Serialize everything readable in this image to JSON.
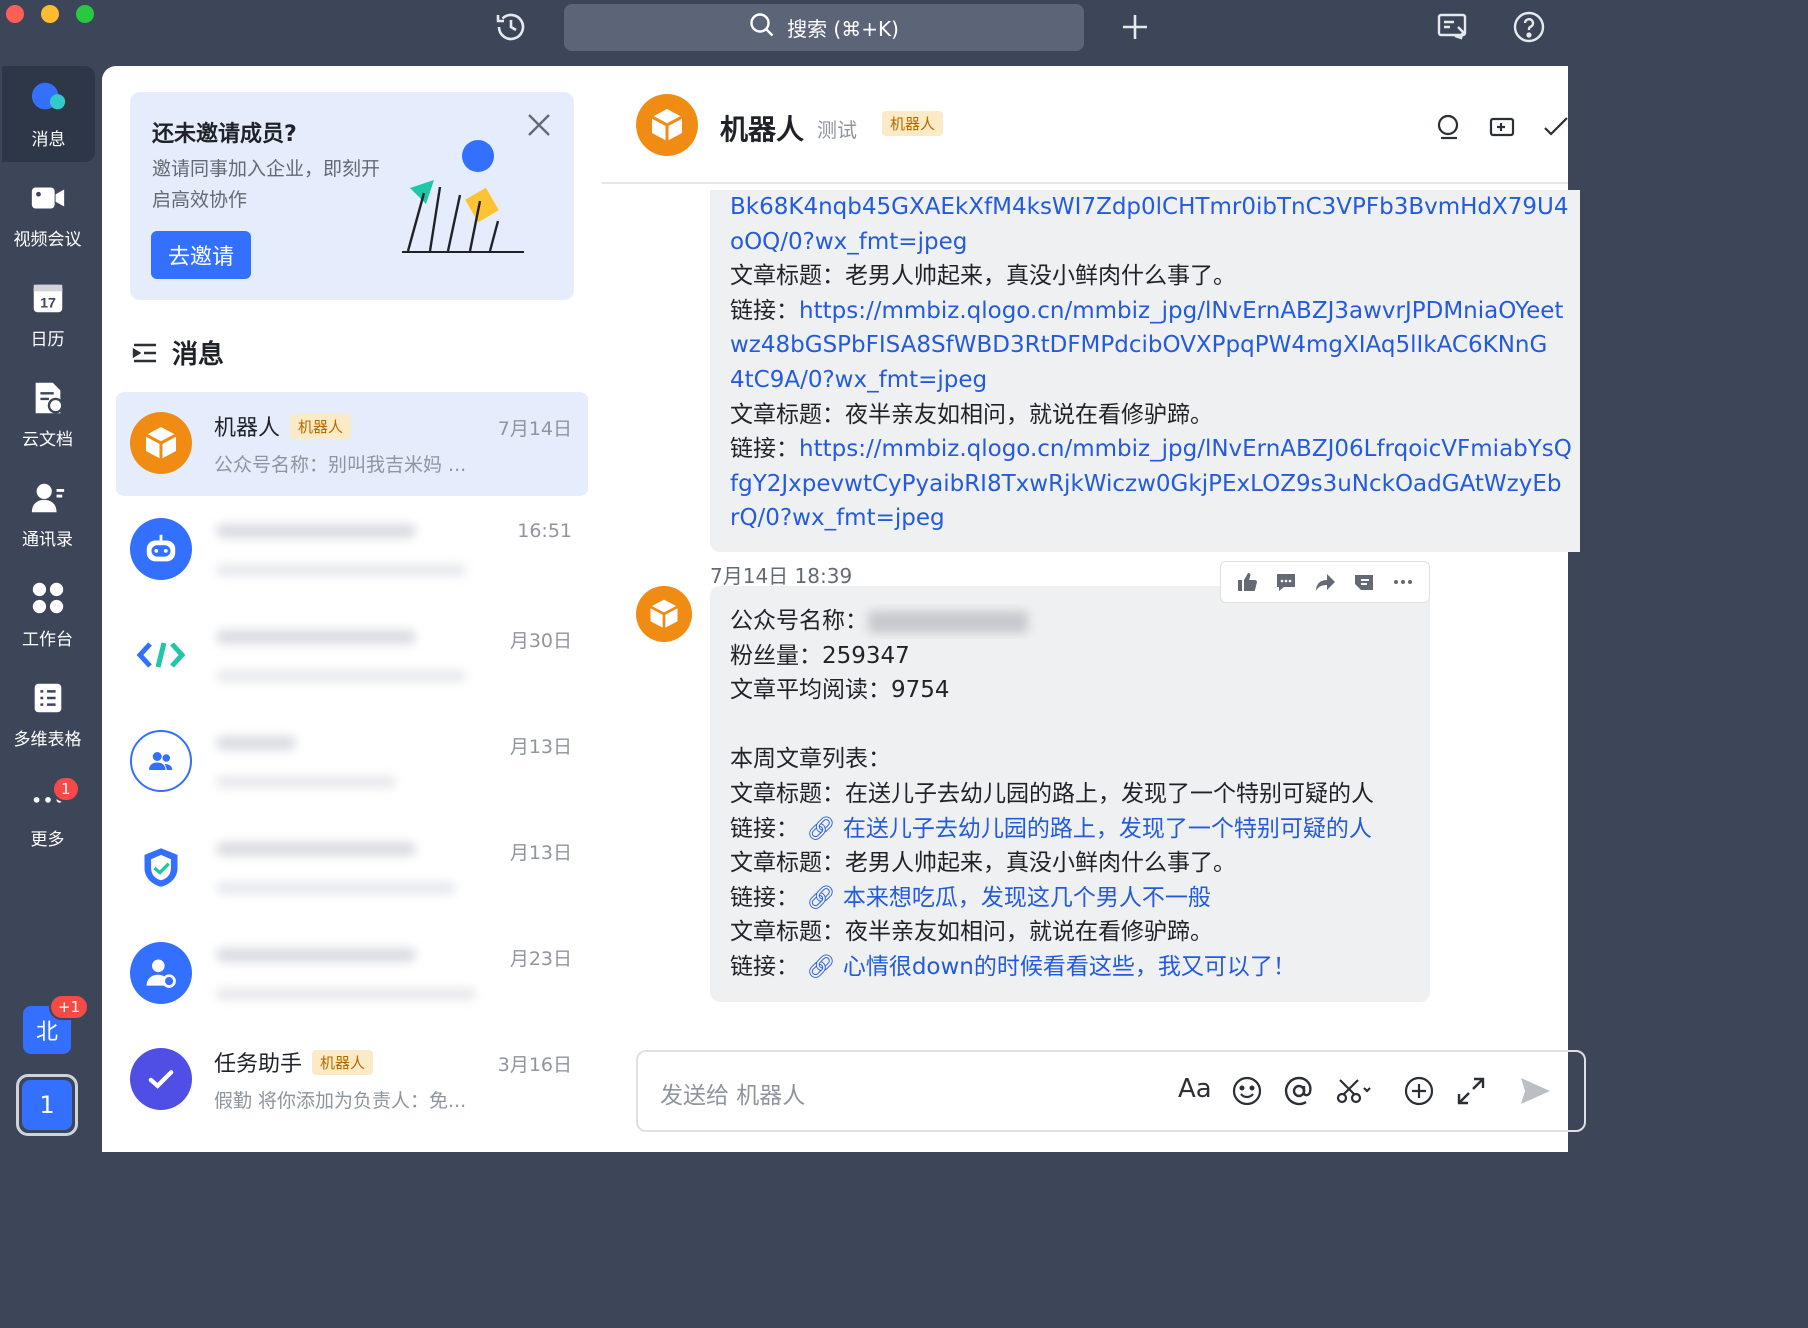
{
  "topbar": {
    "search_label": "搜索 (⌘+K)",
    "icons": [
      "history-icon",
      "search-icon",
      "plus-icon",
      "screen-share-icon",
      "help-icon"
    ],
    "traffic_colors": [
      "#ff5f57",
      "#febc2e",
      "#28c840"
    ]
  },
  "nav": {
    "items": [
      {
        "label": "消息",
        "icon": "chat-bubble-icon"
      },
      {
        "label": "视频会议",
        "icon": "video-camera-icon"
      },
      {
        "label": "日历",
        "icon": "calendar-icon",
        "day": "17"
      },
      {
        "label": "云文档",
        "icon": "cloud-doc-icon"
      },
      {
        "label": "通讯录",
        "icon": "contacts-icon"
      },
      {
        "label": "工作台",
        "icon": "workspace-grid-icon"
      },
      {
        "label": "多维表格",
        "icon": "table-icon"
      },
      {
        "label": "更多",
        "icon": "more-icon",
        "badge": "1"
      }
    ],
    "org_avatar": {
      "text": "北",
      "badge": "+1"
    },
    "user_avatar": {
      "text": "1"
    }
  },
  "invite": {
    "title": "还未邀请成员?",
    "desc": "邀请同事加入企业，即刻开启高效协作",
    "button": "去邀请"
  },
  "messages_header": "消息",
  "conversations": [
    {
      "name": "机器人",
      "tag": "机器人",
      "time": "7月14日",
      "preview": "公众号名称：别叫我吉米妈 ...",
      "avatar_color": "#f08c14"
    },
    {
      "time": "16:51",
      "avatar_color": "#3370ff"
    },
    {
      "time": "月30日",
      "avatar_color": "#ffffff"
    },
    {
      "time": "月13日",
      "avatar_color": "#ffffff"
    },
    {
      "time": "月13日",
      "avatar_color": "#ffffff"
    },
    {
      "time": "月23日",
      "avatar_color": "#3370ff"
    },
    {
      "name": "任务助手",
      "tag": "机器人",
      "time": "3月16日",
      "preview": "假勤 将你添加为负责人：免...",
      "avatar_color": "#4f4fe6"
    }
  ],
  "chat": {
    "title": "机器人",
    "subtitle": "测试",
    "tag": "机器人",
    "msg1": {
      "lines": [
        {
          "text": "Bk68K4nqb45GXAEkXfM4ksWI7Zdp0lCHTmr0ibTnC3VPFb3BvmHdX79U4",
          "link": true
        },
        {
          "text": "oOQ/0?wx_fmt=jpeg",
          "link": true
        },
        {
          "text": "文章标题：老男人帅起来，真没小鲜肉什么事了。"
        },
        {
          "label": "链接：",
          "text": "https://mmbiz.qlogo.cn/mmbiz_jpg/lNvErnABZJ3awvrJPDMniaOYeet",
          "link": true
        },
        {
          "text": "wz48bGSPbFISA8SfWBD3RtDFMPdcibOVXPpqPW4mgXIAq5lIkAC6KNnG",
          "link": true
        },
        {
          "text": "4tC9A/0?wx_fmt=jpeg",
          "link": true
        },
        {
          "text": "文章标题：夜半亲友如相问，就说在看修驴蹄。"
        },
        {
          "label": "链接：",
          "text": "https://mmbiz.qlogo.cn/mmbiz_jpg/lNvErnABZJ06LfrqoicVFmiabYsQ",
          "link": true
        },
        {
          "text": "fgY2JxpevwtCyPyaibRI8TxwRjkWiczw0GkjPExLOZ9s3uNckOadGAtWzyEb",
          "link": true
        },
        {
          "text": "rQ/0?wx_fmt=jpeg",
          "link": true
        }
      ]
    },
    "timestamp": "7月14日 18:39",
    "msg2": {
      "account_label": "公众号名称：",
      "fans": "粉丝量：259347",
      "avg_read": "文章平均阅读：9754",
      "list_title": "本周文章列表：",
      "articles": [
        {
          "title": "文章标题：在送儿子去幼儿园的路上，发现了一个特别可疑的人",
          "link_label": "链接：",
          "link": "在送儿子去幼儿园的路上，发现了一个特别可疑的人"
        },
        {
          "title": "文章标题：老男人帅起来，真没小鲜肉什么事了。",
          "link_label": "链接：",
          "link": "本来想吃瓜，发现这几个男人不一般"
        },
        {
          "title": "文章标题：夜半亲友如相问，就说在看修驴蹄。",
          "link_label": "链接：",
          "link": "心情很down的时候看看这些，我又可以了！"
        }
      ]
    },
    "hover_actions": [
      "thumbs-up-icon",
      "reply-icon",
      "forward-icon",
      "pin-icon",
      "more-icon"
    ],
    "input_placeholder": "发送给 机器人"
  }
}
